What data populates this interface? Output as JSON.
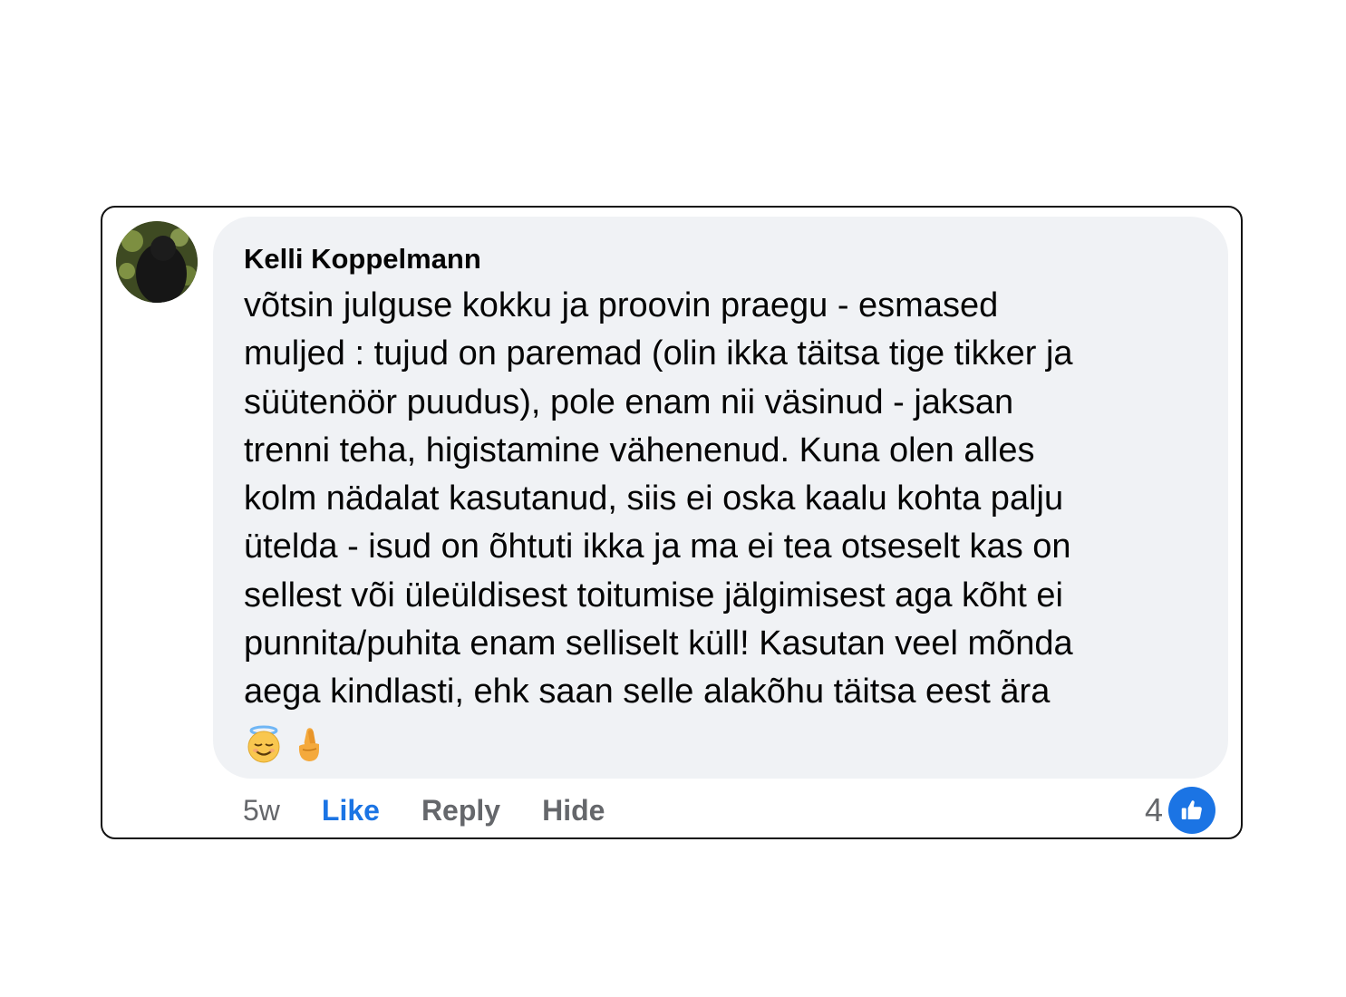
{
  "comment": {
    "author": "Kelli Koppelmann",
    "text": "võtsin julguse kokku ja proovin praegu - esmased\nmuljed : tujud on paremad (olin ikka täitsa tige tikker ja\nsüütenöör puudus), pole enam nii väsinud - jaksan\ntrenni teha, higistamine vähenenud. Kuna olen alles\nkolm nädalat kasutanud, siis ei oska kaalu kohta palju\nütelda - isud on õhtuti ikka ja ma ei tea otseselt kas on\nsellest või üleüldisest toitumise jälgimisest aga kõht ei\npunnita/puhita enam selliselt küll! Kasutan veel mõnda\naega kindlasti, ehk saan selle alakõhu täitsa eest ära",
    "emojis": [
      "smiling-face-with-halo",
      "crossed-fingers"
    ]
  },
  "actions": {
    "time": "5w",
    "like": "Like",
    "reply": "Reply",
    "hide": "Hide"
  },
  "reactions": {
    "count": "4",
    "icon": "thumbs-up-icon"
  },
  "colors": {
    "bubble": "#f0f2f5",
    "like_blue": "#1b74e4",
    "muted_text": "#65676b",
    "text": "#050505"
  }
}
